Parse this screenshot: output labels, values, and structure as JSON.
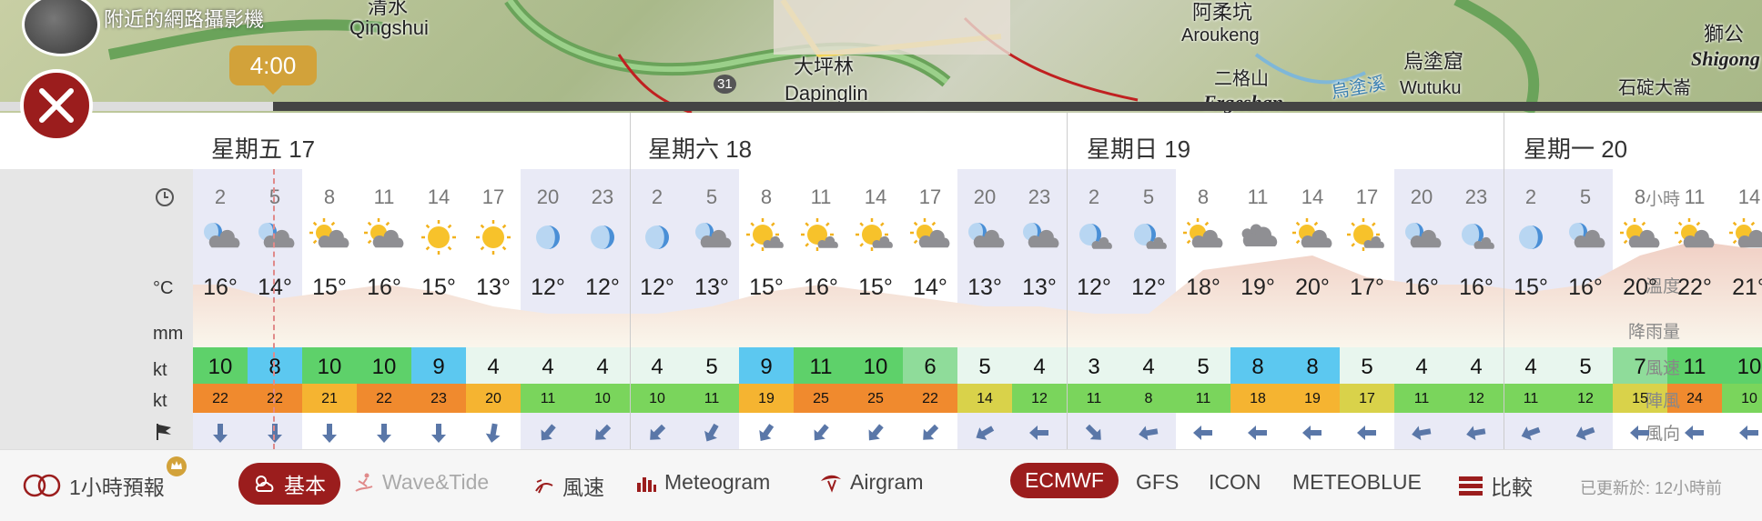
{
  "map": {
    "camera_label": "附近的網路攝影機",
    "places": [
      {
        "text": "清水",
        "cls": ""
      },
      {
        "text": "Qingshui",
        "cls": ""
      },
      {
        "text": "大坪林",
        "cls": ""
      },
      {
        "text": "Dapinglin",
        "cls": ""
      },
      {
        "text": "阿柔坑",
        "cls": ""
      },
      {
        "text": "Aroukeng",
        "cls": "sm"
      },
      {
        "text": "二格山",
        "cls": "sm"
      },
      {
        "text": "Ergeshan",
        "cls": "it"
      },
      {
        "text": "烏塗窟",
        "cls": ""
      },
      {
        "text": "Wutuku",
        "cls": "sm"
      },
      {
        "text": "烏塗溪",
        "cls": "sm"
      },
      {
        "text": "石碇大崙",
        "cls": "sm"
      },
      {
        "text": "獅公",
        "cls": ""
      },
      {
        "text": "Shigong",
        "cls": "it"
      },
      {
        "text": "31",
        "cls": "sm"
      }
    ],
    "time_bubble": "4:00"
  },
  "days": [
    "星期五 17",
    "星期六 18",
    "星期日 19",
    "星期一 20"
  ],
  "labels": {
    "hour": "小時",
    "temp": "溫度",
    "temp_unit": "°C",
    "rain": "降雨量",
    "rain_unit": "mm",
    "wind": "風速",
    "wind_unit": "kt",
    "gust": "陣風",
    "gust_unit": "kt",
    "dir": "風向"
  },
  "hours": [
    "2",
    "5",
    "8",
    "11",
    "14",
    "17",
    "20",
    "23",
    "2",
    "5",
    "8",
    "11",
    "14",
    "17",
    "20",
    "23",
    "2",
    "5",
    "8",
    "11",
    "14",
    "17",
    "20",
    "23",
    "2",
    "5",
    "8",
    "11",
    "14"
  ],
  "night_flags": [
    1,
    1,
    0,
    0,
    0,
    0,
    1,
    1,
    1,
    1,
    0,
    0,
    0,
    0,
    1,
    1,
    1,
    1,
    0,
    0,
    0,
    0,
    1,
    1,
    1,
    1,
    0,
    0,
    0
  ],
  "weather_icons": [
    "moon-cloud",
    "moon-cloud",
    "sun-cloud",
    "sun-cloud",
    "sun",
    "sun",
    "moon",
    "moon",
    "moon",
    "moon-cloud",
    "sun-smallcloud",
    "sun-smallcloud",
    "sun-smallcloud",
    "sun-cloud",
    "moon-cloud",
    "moon-cloud",
    "moon-smallcloud",
    "moon-smallcloud",
    "sun-cloud",
    "cloud",
    "sun-cloud",
    "sun-smallcloud",
    "moon-cloud",
    "moon-smallcloud",
    "moon",
    "moon-cloud",
    "sun-cloud",
    "sun-cloud",
    "sun-cloud"
  ],
  "temps": [
    "16°",
    "14°",
    "15°",
    "16°",
    "15°",
    "13°",
    "12°",
    "12°",
    "12°",
    "13°",
    "15°",
    "16°",
    "15°",
    "14°",
    "13°",
    "13°",
    "12°",
    "12°",
    "18°",
    "19°",
    "20°",
    "17°",
    "16°",
    "16°",
    "15°",
    "16°",
    "20°",
    "22°",
    "21°"
  ],
  "wind_speed": [
    "10",
    "8",
    "10",
    "10",
    "9",
    "4",
    "4",
    "4",
    "4",
    "5",
    "9",
    "11",
    "10",
    "6",
    "5",
    "4",
    "3",
    "4",
    "5",
    "8",
    "8",
    "5",
    "4",
    "4",
    "4",
    "5",
    "7",
    "11",
    "10"
  ],
  "gusts": [
    "22",
    "22",
    "21",
    "22",
    "23",
    "20",
    "11",
    "10",
    "10",
    "11",
    "19",
    "25",
    "25",
    "22",
    "14",
    "12",
    "11",
    "8",
    "11",
    "18",
    "19",
    "17",
    "11",
    "12",
    "11",
    "12",
    "15",
    "24",
    "10"
  ],
  "wind_dir_deg": [
    0,
    0,
    0,
    0,
    0,
    10,
    40,
    45,
    45,
    30,
    35,
    40,
    40,
    45,
    60,
    90,
    315,
    80,
    90,
    90,
    90,
    90,
    80,
    80,
    70,
    70,
    90,
    90,
    90
  ],
  "colors": {
    "accent": "#9b1d1d",
    "gold": "#d2a23a",
    "arrow": "#5a77a8",
    "night_shade": "#e9eaf6"
  },
  "toolbar": {
    "hourly_toggle": "1小時預報",
    "tabs": [
      {
        "label": "基本",
        "icon": "cloud-sun-icon",
        "active": true
      },
      {
        "label": "Wave&Tide",
        "icon": "surfer-icon",
        "active": false,
        "muted": true
      },
      {
        "label": "風速",
        "icon": "wind-icon",
        "active": false
      },
      {
        "label": "Meteogram",
        "icon": "bar-chart-icon",
        "active": false
      },
      {
        "label": "Airgram",
        "icon": "paraglider-icon",
        "active": false
      }
    ],
    "models": [
      {
        "label": "ECMWF",
        "active": true
      },
      {
        "label": "GFS",
        "active": false
      },
      {
        "label": "ICON",
        "active": false
      },
      {
        "label": "METEOBLUE",
        "active": false
      }
    ],
    "compare": "比較",
    "updated": "已更新於: 12小時前"
  }
}
